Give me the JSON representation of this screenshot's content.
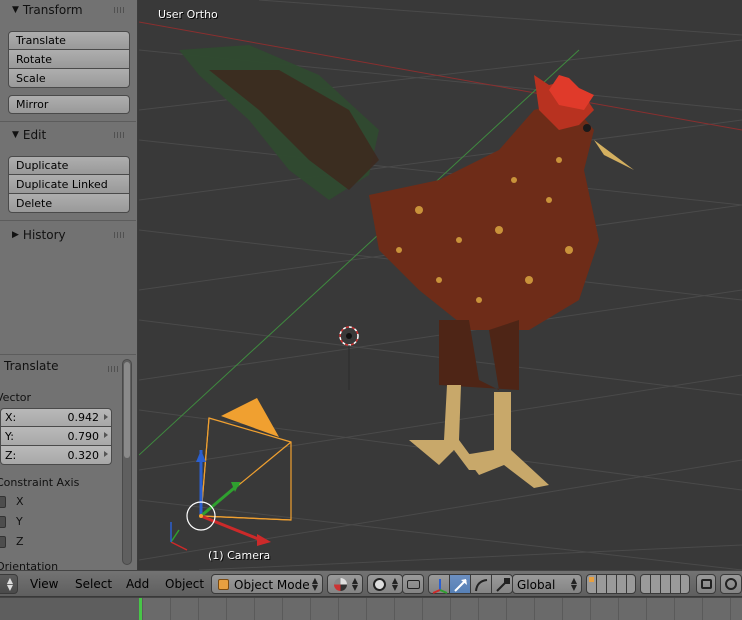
{
  "toolshelf": {
    "transform_title": "Transform",
    "transform_buttons": [
      "Translate",
      "Rotate",
      "Scale"
    ],
    "mirror_label": "Mirror",
    "edit_title": "Edit",
    "edit_buttons": [
      "Duplicate",
      "Duplicate Linked",
      "Delete"
    ],
    "history_title": "History"
  },
  "redo_panel": {
    "title": "Translate",
    "vector_label": "Vector",
    "vector": [
      {
        "axis": "X:",
        "value": "0.942"
      },
      {
        "axis": "Y:",
        "value": "0.790"
      },
      {
        "axis": "Z:",
        "value": "0.320"
      }
    ],
    "constraint_label": "Constraint Axis",
    "constraint_axes": [
      "X",
      "Y",
      "Z"
    ],
    "orientation_label": "Orientation"
  },
  "viewport": {
    "view_name": "User Ortho",
    "object_label": "(1) Camera",
    "colors": {
      "background": "#393939",
      "grid": "#4a4a4a",
      "x_axis": "#8a2f2f",
      "y_axis": "#3f8a3f",
      "selection": "#f0a030"
    }
  },
  "header": {
    "menus": [
      "View",
      "Select",
      "Add",
      "Object"
    ],
    "mode": "Object Mode",
    "orientation": "Global",
    "icons": [
      "editor-type-icon",
      "viewport-shading-icon",
      "pivot-point-icon",
      "manipulator-icon",
      "translate-manipulator-icon",
      "rotate-manipulator-icon",
      "scale-manipulator-icon",
      "layers-icon",
      "render-icon",
      "camera-icon"
    ]
  },
  "timeline": {
    "accent": "#47c547"
  }
}
